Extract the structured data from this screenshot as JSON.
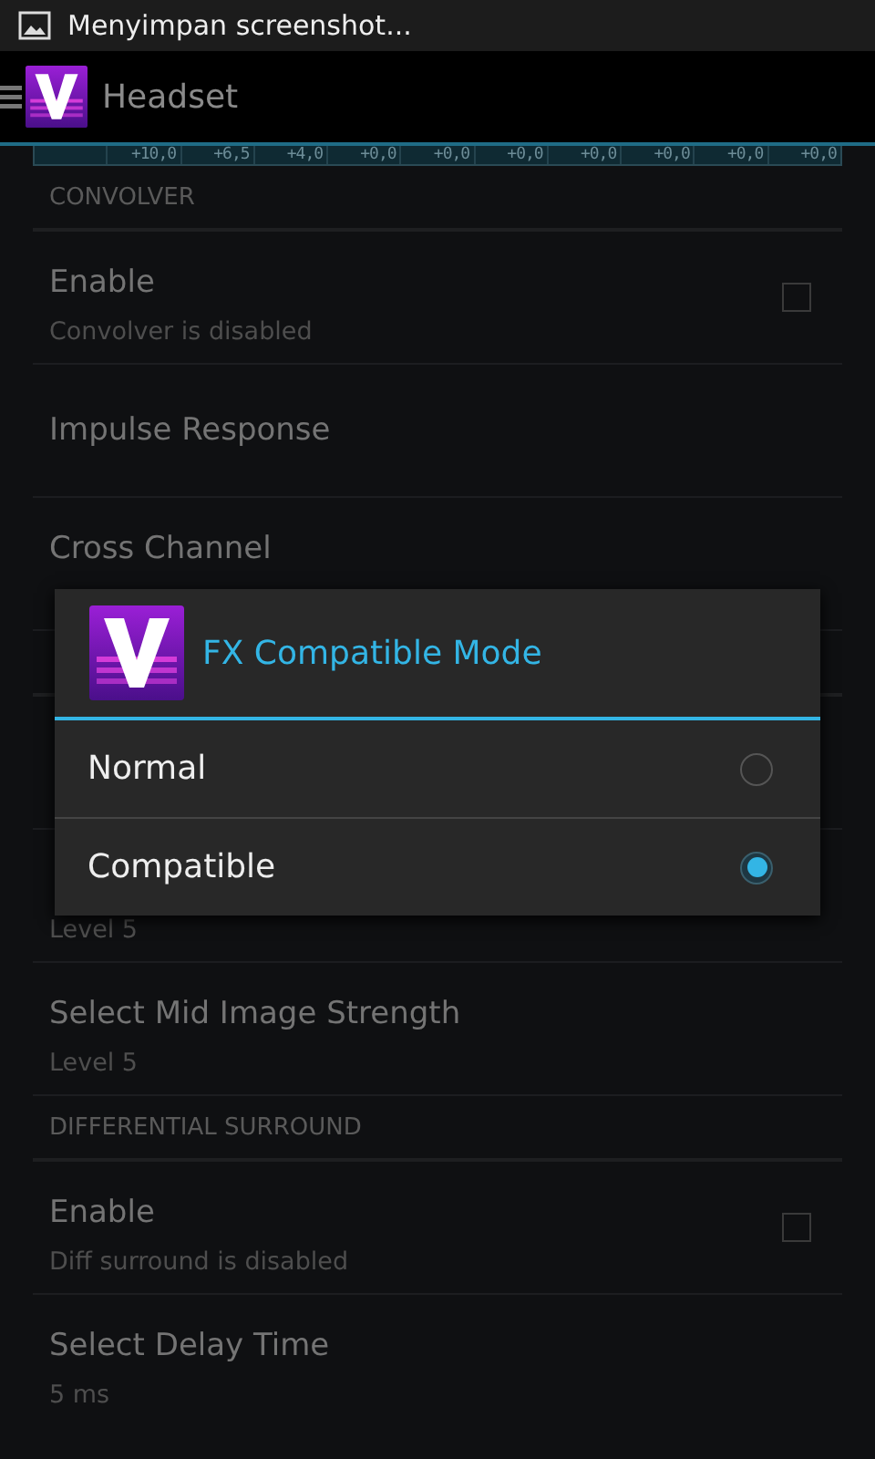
{
  "status_bar": {
    "notification": "Menyimpan screenshot..."
  },
  "action_bar": {
    "title": "Headset"
  },
  "eq_strip": [
    "+10,0",
    "+6,5",
    "+4,0",
    "+0,0",
    "+0,0",
    "+0,0",
    "+0,0",
    "+0,0",
    "+0,0",
    "+0,0"
  ],
  "list": [
    {
      "kind": "header",
      "label": "CONVOLVER"
    },
    {
      "kind": "row",
      "title": "Enable",
      "subtitle": "Convolver is disabled",
      "checkbox": {
        "checked": false
      }
    },
    {
      "kind": "row",
      "title": "Impulse Response"
    },
    {
      "kind": "row",
      "title": "Cross Channel"
    },
    {
      "kind": "header"
    },
    {
      "kind": "row"
    },
    {
      "kind": "row",
      "subtitle": "Level 5"
    },
    {
      "kind": "row",
      "title": "Select Mid Image Strength",
      "subtitle": "Level 5"
    },
    {
      "kind": "header",
      "label": "DIFFERENTIAL SURROUND"
    },
    {
      "kind": "row",
      "title": "Enable",
      "subtitle": "Diff surround is disabled",
      "checkbox": {
        "checked": false
      }
    },
    {
      "kind": "row",
      "title": "Select Delay Time",
      "subtitle": "5 ms"
    }
  ],
  "dialog": {
    "title": "FX Compatible Mode",
    "options": [
      {
        "label": "Normal",
        "selected": false
      },
      {
        "label": "Compatible",
        "selected": true
      }
    ]
  }
}
